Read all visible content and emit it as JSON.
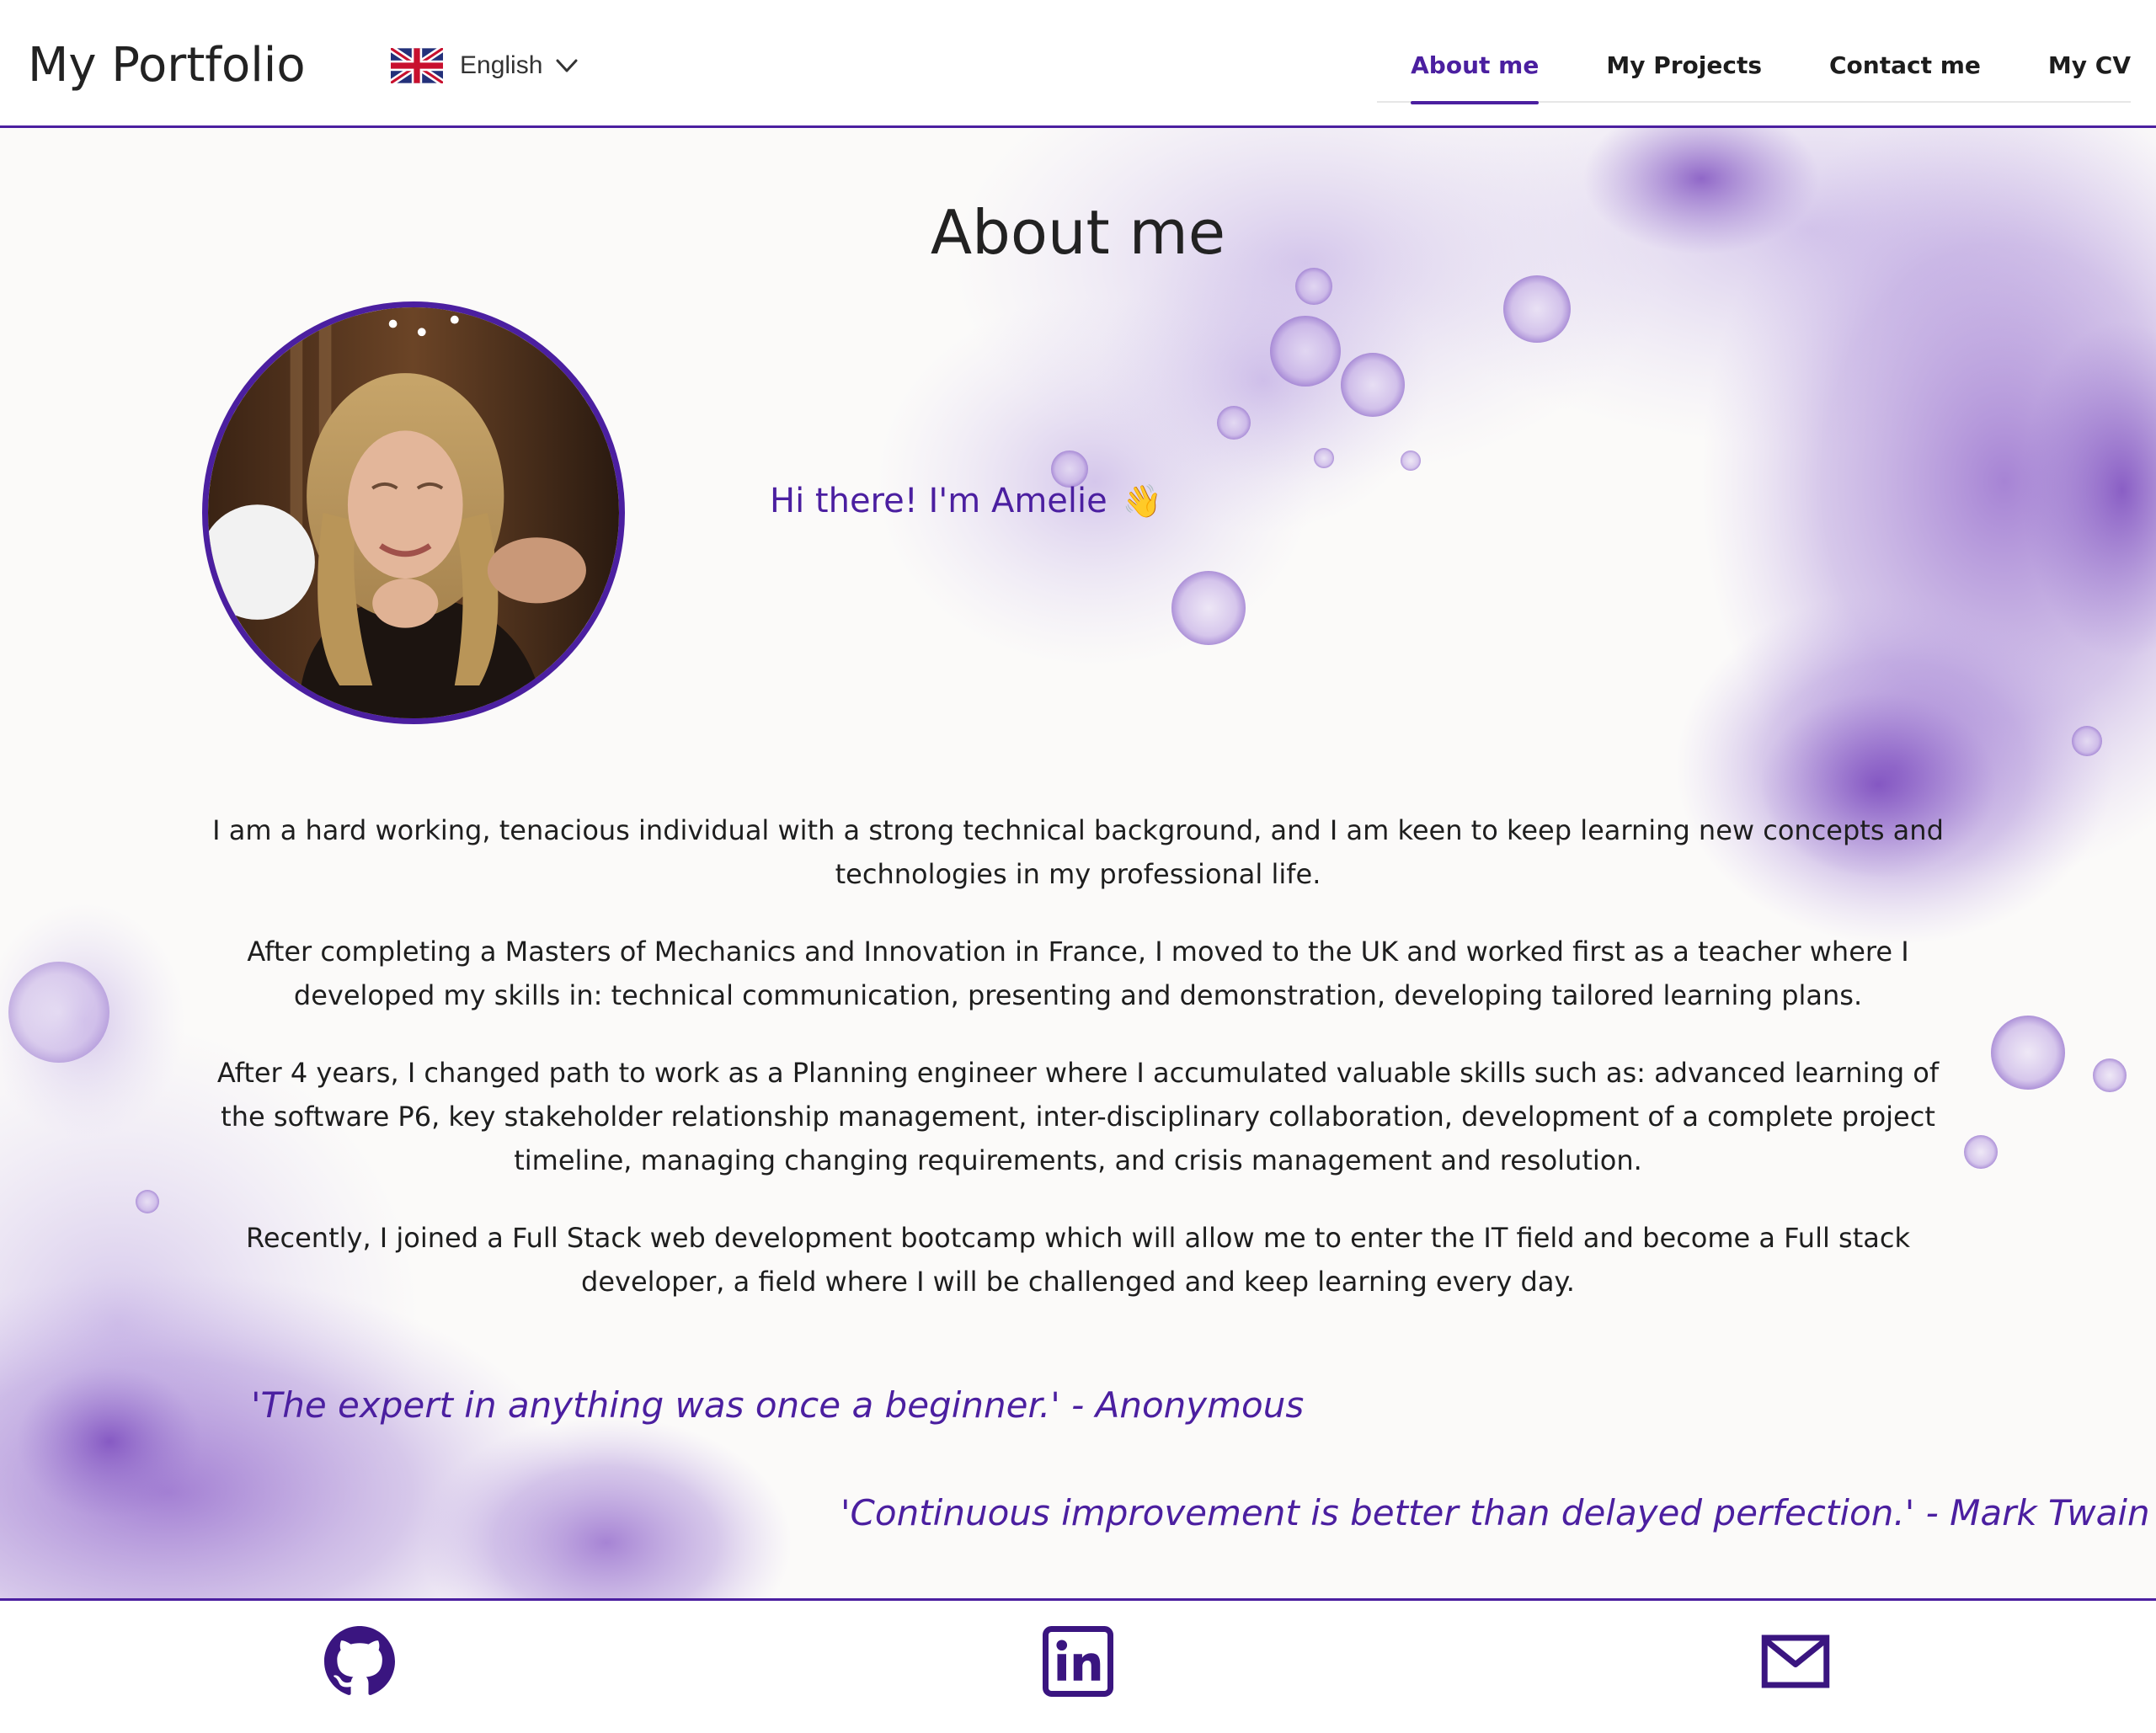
{
  "header": {
    "brand": "My Portfolio",
    "language": {
      "label": "English",
      "flag_icon": "uk-flag-icon"
    },
    "nav": [
      {
        "label": "About me",
        "active": true
      },
      {
        "label": "My Projects",
        "active": false
      },
      {
        "label": "Contact me",
        "active": false
      },
      {
        "label": "My CV",
        "active": false
      }
    ]
  },
  "main": {
    "title": "About me",
    "greeting": "Hi there! I'm Amelie",
    "greeting_emoji": "👋",
    "bio": [
      "I am a hard working, tenacious individual with a strong technical background, and I am keen to keep learning new concepts and technologies in my professional life.",
      "After completing a Masters of Mechanics and Innovation in France, I moved to the UK and worked first as a teacher where I developed my skills in: technical communication, presenting and demonstration, developing tailored learning plans.",
      "After 4 years, I changed path to work as a Planning engineer where I accumulated valuable skills such as: advanced learning of the software P6, key stakeholder relationship management, inter-disciplinary collaboration, development of a complete project timeline, managing changing requirements, and crisis management and resolution.",
      "Recently, I joined a Full Stack web development bootcamp which will allow me to enter the IT field and become a Full stack developer, a field where I will be challenged and keep learning every day."
    ],
    "quotes": [
      "'The expert in anything was once a beginner.' - Anonymous",
      "'Continuous improvement is better than delayed perfection.' - Mark Twain"
    ]
  },
  "footer": {
    "icons": [
      "github-icon",
      "linkedin-icon",
      "mail-icon"
    ]
  },
  "colors": {
    "accent": "#4b1fa0",
    "background": "#fbfaf9",
    "watercolor": "#9c7ad0"
  }
}
